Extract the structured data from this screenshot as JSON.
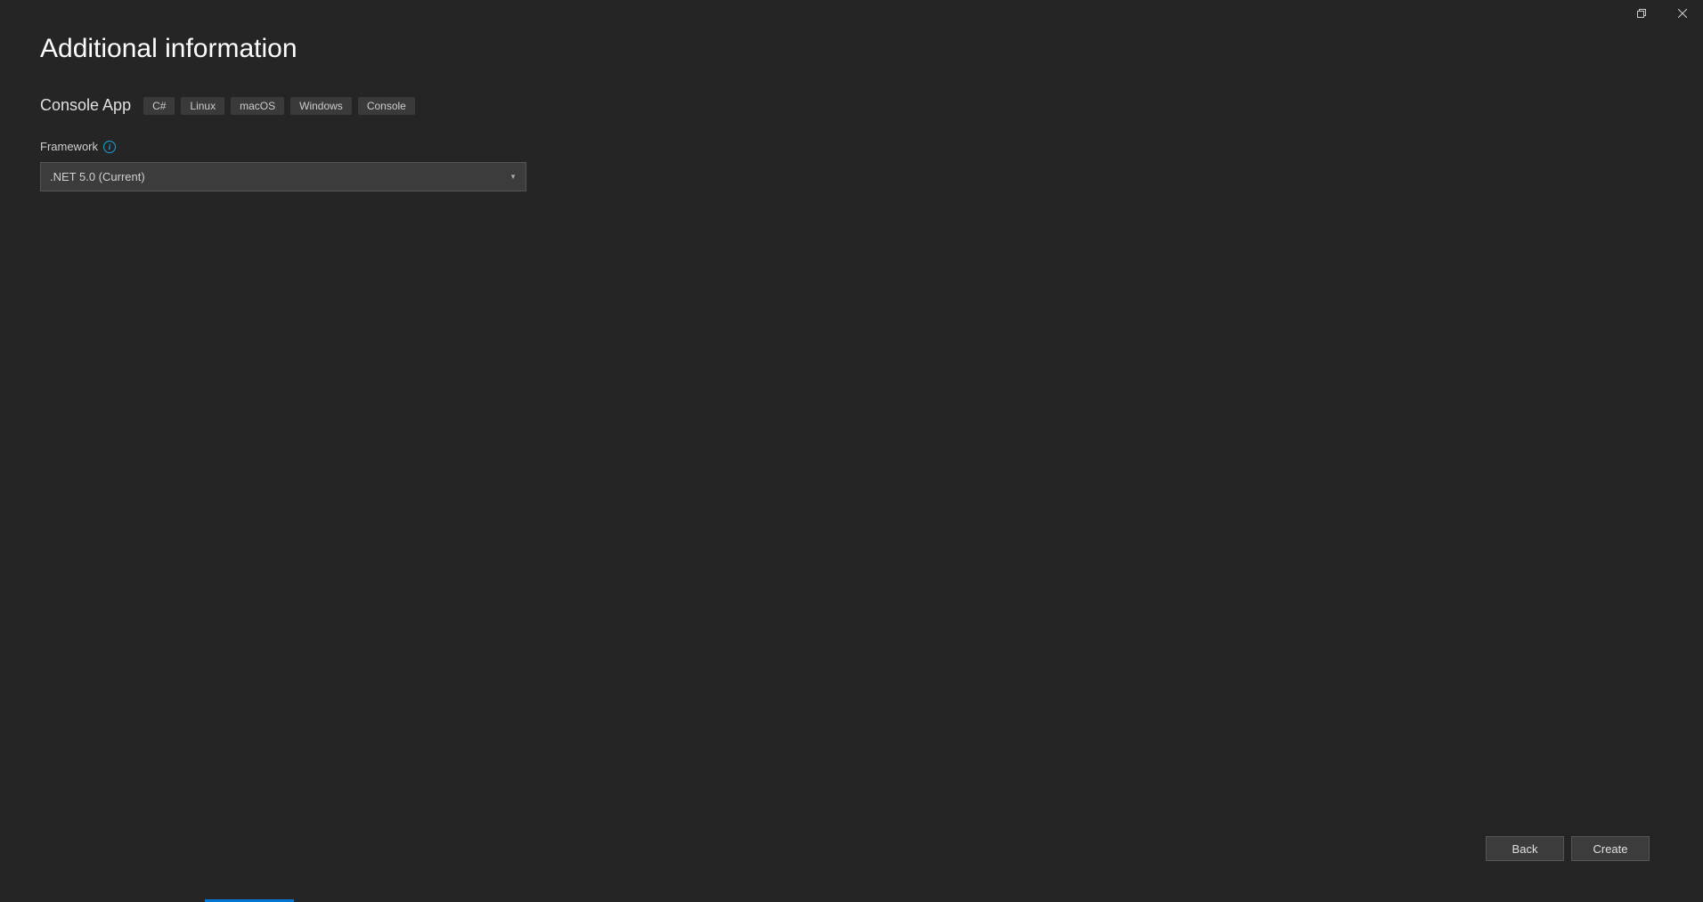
{
  "page": {
    "title": "Additional information"
  },
  "template": {
    "name": "Console App",
    "tags": [
      "C#",
      "Linux",
      "macOS",
      "Windows",
      "Console"
    ]
  },
  "framework": {
    "label": "Framework",
    "selected": ".NET 5.0 (Current)"
  },
  "footer": {
    "back_label": "Back",
    "create_label": "Create"
  }
}
